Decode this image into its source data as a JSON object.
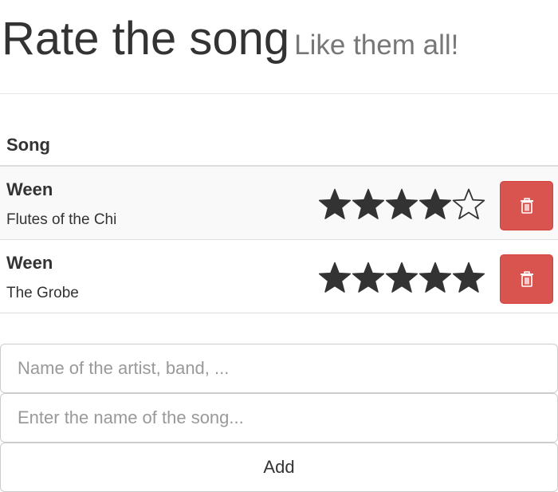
{
  "header": {
    "title": "Rate the song",
    "subtitle": "Like them all!"
  },
  "table": {
    "column_header": "Song",
    "rows": [
      {
        "artist": "Ween",
        "title": "Flutes of the Chi",
        "rating": 4,
        "max_rating": 5,
        "delete_icon": "trash-icon"
      },
      {
        "artist": "Ween",
        "title": "The Grobe",
        "rating": 5,
        "max_rating": 5,
        "delete_icon": "trash-icon"
      }
    ]
  },
  "form": {
    "artist_placeholder": "Name of the artist, band, ...",
    "artist_value": "",
    "song_placeholder": "Enter the name of the song...",
    "song_value": "",
    "add_label": "Add"
  },
  "colors": {
    "star": "#333333",
    "delete_button": "#d9534f",
    "subtitle": "#777777"
  }
}
